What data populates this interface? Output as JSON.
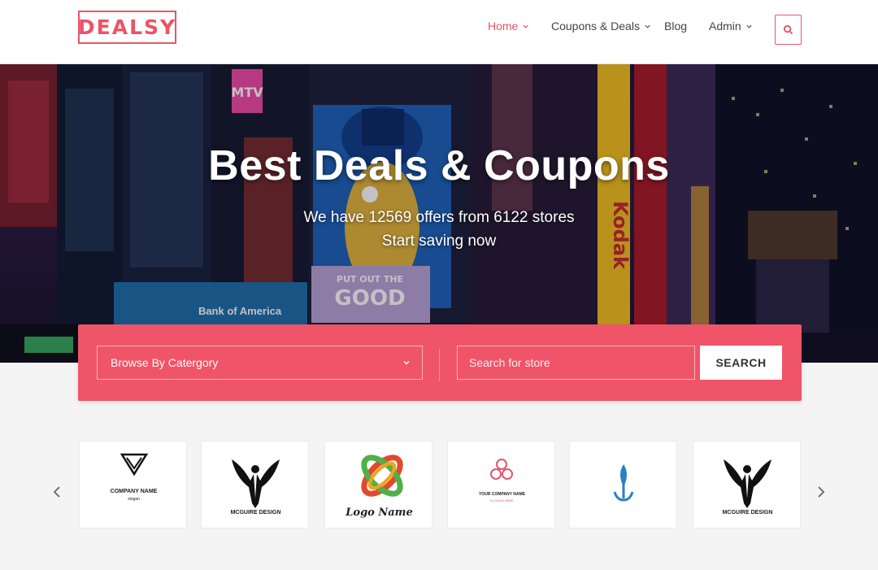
{
  "brand": {
    "logo_text": "DEALSY",
    "accent_color": "#e85566"
  },
  "nav": {
    "items": [
      {
        "label": "Home",
        "active": true,
        "has_dropdown": true
      },
      {
        "label": "Coupons & Deals",
        "active": false,
        "has_dropdown": true
      },
      {
        "label": "Blog",
        "active": false,
        "has_dropdown": false
      },
      {
        "label": "Admin",
        "active": false,
        "has_dropdown": true
      }
    ],
    "search_icon": "search-icon"
  },
  "hero": {
    "title": "Best Deals & Coupons",
    "subtitle_line1": "We have 12569 offers from 6122 stores",
    "subtitle_line2": "Start saving now",
    "background_signs": [
      "MTV",
      "MR PEANUT",
      "Kodak",
      "Bank of America",
      "PUT OUT THE GOOD STUFF"
    ]
  },
  "search": {
    "category_placeholder": "Browse By Catergory",
    "store_placeholder": "Search for store",
    "submit_label": "SEARCH",
    "panel_color": "#f05468"
  },
  "stores": {
    "prev_icon": "chevron-left-icon",
    "next_icon": "chevron-right-icon",
    "cards": [
      {
        "name": "COMPANY NAME",
        "tagline": "slogan",
        "icon": "triangle-bird-logo"
      },
      {
        "name": "MCGUIRE DESIGN",
        "icon": "eagle-logo"
      },
      {
        "name": "Logo Name",
        "icon": "interlocking-rings-logo"
      },
      {
        "name": "YOUR COMPANY NAME",
        "tagline": "SLOGAN HERE",
        "icon": "hexagon-cluster-logo"
      },
      {
        "name": "",
        "icon": "anchor-leaf-logo"
      },
      {
        "name": "MCGUIRE DESIGN",
        "icon": "eagle-logo"
      }
    ]
  }
}
